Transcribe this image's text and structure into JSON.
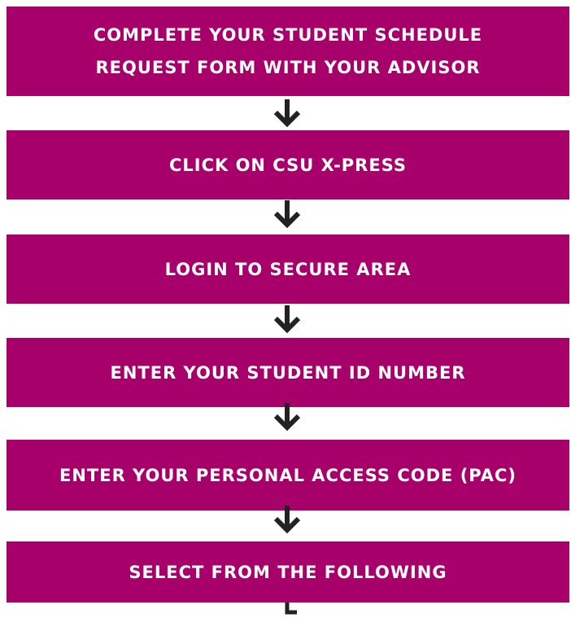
{
  "flowchart": {
    "steps": [
      {
        "lines": [
          "COMPLETE YOUR STUDENT SCHEDULE",
          "REQUEST FORM WITH YOUR ADVISOR"
        ]
      },
      {
        "lines": [
          "CLICK ON CSU X-PRESS"
        ]
      },
      {
        "lines": [
          "LOGIN TO SECURE AREA"
        ]
      },
      {
        "lines": [
          "ENTER YOUR STUDENT ID NUMBER"
        ]
      },
      {
        "lines": [
          "ENTER YOUR PERSONAL ACCESS CODE (PAC)"
        ]
      },
      {
        "lines": [
          "SELECT FROM THE FOLLOWING"
        ]
      }
    ],
    "colors": {
      "box": "#a8006b",
      "text": "#ffffff",
      "arrow": "#222222"
    }
  }
}
